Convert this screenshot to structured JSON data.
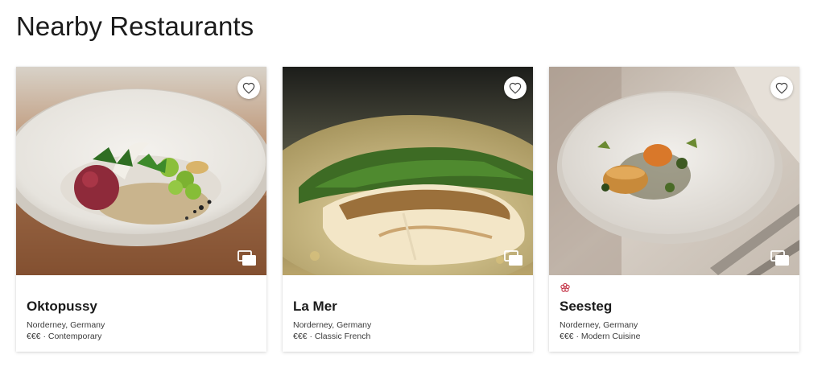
{
  "page": {
    "title": "Nearby Restaurants"
  },
  "colors": {
    "michelin_star": "#c0283c",
    "text": "#1b1b1b"
  },
  "restaurants": [
    {
      "name": "Oktopussy",
      "location": "Norderney, Germany",
      "price": "€€€",
      "separator": "·",
      "cuisine": "Contemporary",
      "has_michelin_icon": false,
      "favorite_icon": "heart-outline-icon",
      "gallery_icon": "image-gallery-icon"
    },
    {
      "name": "La Mer",
      "location": "Norderney, Germany",
      "price": "€€€",
      "separator": "·",
      "cuisine": "Classic French",
      "has_michelin_icon": false,
      "favorite_icon": "heart-outline-icon",
      "gallery_icon": "image-gallery-icon"
    },
    {
      "name": "Seesteg",
      "location": "Norderney, Germany",
      "price": "€€€",
      "separator": "·",
      "cuisine": "Modern Cuisine",
      "has_michelin_icon": true,
      "favorite_icon": "heart-outline-icon",
      "gallery_icon": "image-gallery-icon"
    }
  ]
}
